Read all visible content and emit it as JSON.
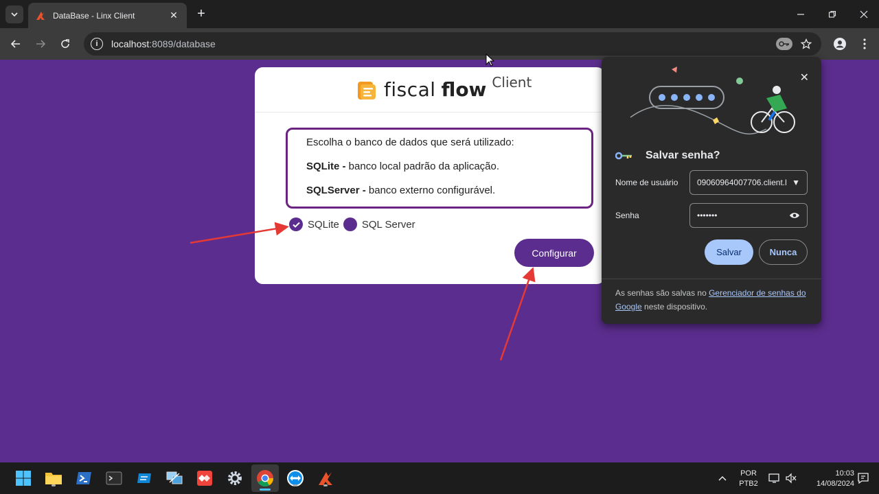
{
  "browser": {
    "tab_title": "DataBase - Linx Client",
    "url_host": "localhost",
    "url_rest": ":8089/database"
  },
  "app": {
    "logo_word1": "fiscal",
    "logo_word2": "flow",
    "logo_suffix": "Client",
    "info_intro": "Escolha o banco de dados que será utilizado:",
    "option1_name": "SQLite -",
    "option1_desc": " banco local padrão da aplicação.",
    "option2_name": "SQLServer -",
    "option2_desc": " banco externo configurável.",
    "radio1_label": "SQLite",
    "radio2_label": "SQL Server",
    "radio_selected": "SQLite",
    "configure_label": "Configurar"
  },
  "password_popup": {
    "title": "Salvar senha?",
    "username_label": "Nome de usuário",
    "username_value": "09060964007706.client.l",
    "password_label": "Senha",
    "password_value": "•••••••",
    "save_label": "Salvar",
    "never_label": "Nunca",
    "footer_pre": "As senhas são salvas no ",
    "footer_link": "Gerenciador de senhas do Google",
    "footer_post": " neste dispositivo."
  },
  "taskbar": {
    "lang_top": "POR",
    "lang_bottom": "PTB2",
    "time": "10:03",
    "date": "14/08/2024"
  },
  "colors": {
    "page_bg": "#5b2d8e",
    "accent": "#5b2d8e",
    "info_border": "#6a2380",
    "annotation_arrow": "#e53935"
  }
}
